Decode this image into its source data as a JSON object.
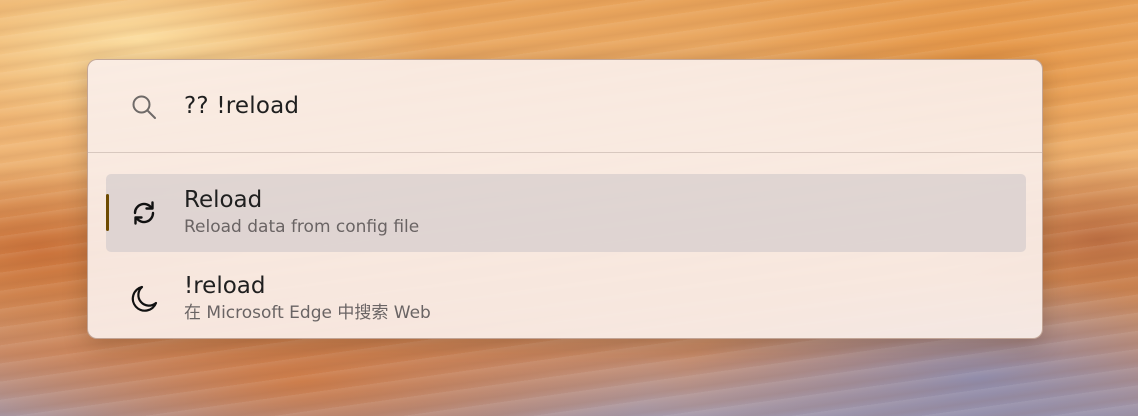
{
  "search": {
    "query": "?? !reload",
    "icon": "search-icon"
  },
  "results": [
    {
      "title": "Reload",
      "subtitle": "Reload data from config file",
      "icon": "refresh-icon",
      "selected": true
    },
    {
      "title": "!reload",
      "subtitle": "在 Microsoft Edge 中搜索 Web",
      "icon": "moon-icon",
      "selected": false
    }
  ],
  "colors": {
    "selection_indicator": "#6e4a00",
    "panel_background": "#faeee8"
  }
}
